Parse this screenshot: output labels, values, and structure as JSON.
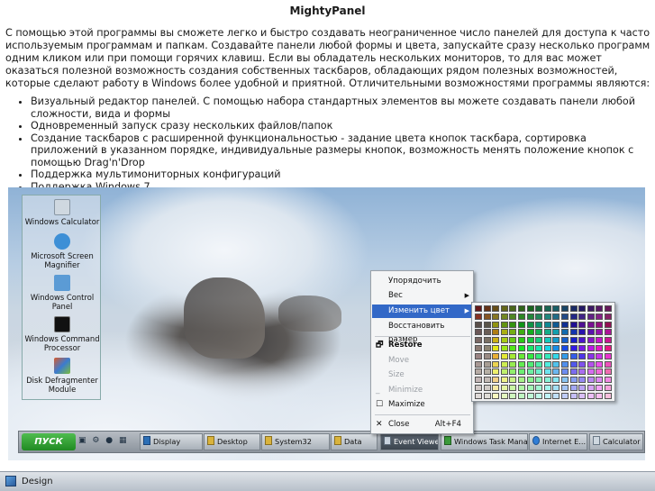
{
  "title": "MightyPanel",
  "intro": "С помощью этой программы вы сможете легко и быстро создавать неограниченное число панелей для доступа к часто используемым программам и папкам. Создавайте панели любой формы и цвета, запускайте сразу несколько программ одним кликом или при помощи горячих клавиш. Если вы обладатель нескольких мониторов, то для вас может оказаться полезной возможность создания собственных таскбаров, обладающих рядом полезных возможностей, которые сделают работу в Windows более удобной и приятной. Отличительными возможностями программы являются:",
  "features": [
    "Визуальный редактор панелей. С помощью набора стандартных элементов вы можете создавать панели любой сложности, вида и формы",
    "Одновременный запуск сразу нескольких файлов/папок",
    "Создание таскбаров с расширенной функциональностью - задание цвета кнопок таскбара, сортировка приложений в указанном порядке, индивидуальные размеры кнопок, возможность менять положение кнопок с помощью Drag'n'Drop",
    "Поддержка мультимониторных конфигураций",
    "Поддержка Windows 7"
  ],
  "panel_items": [
    {
      "label": "Windows Calculator",
      "icon": "calculator-icon",
      "color": "#cfd8e0"
    },
    {
      "label": "Microsoft Screen Magnifier",
      "icon": "magnifier-icon",
      "color": "#3d8fd6"
    },
    {
      "label": "Windows Control Panel",
      "icon": "control-panel-icon",
      "color": "#5b9bd5"
    },
    {
      "label": "Windows Command Processor",
      "icon": "command-prompt-icon",
      "color": "#111111"
    },
    {
      "label": "Disk Defragmenter Module",
      "icon": "defragmenter-icon",
      "color": "#d95a2b"
    }
  ],
  "taskbar": {
    "start_label": "ПУСК",
    "buttons": [
      "Display",
      "Desktop",
      "System32",
      "Data",
      "Event Viewer",
      "Windows Task Mana...",
      "Internet E...",
      "Calculator"
    ]
  },
  "context_menu": {
    "items": [
      "Упорядочить",
      "Вес",
      "Изменить цвет",
      "Восстановить размер",
      "Restore",
      "Move",
      "Size",
      "Minimize",
      "Maximize",
      "Close"
    ],
    "close_accel": "Alt+F4"
  },
  "status_bar": {
    "label": "Design"
  },
  "colors": {
    "highlight": "#3268c7",
    "start_green": "#2a9a2c"
  }
}
